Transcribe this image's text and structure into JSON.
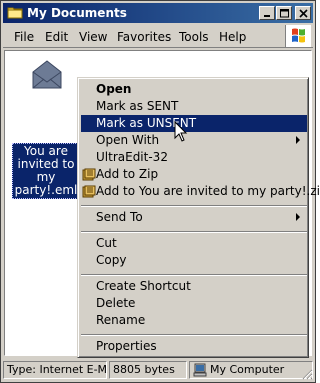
{
  "window": {
    "title": "My Documents"
  },
  "menubar": {
    "items": [
      "File",
      "Edit",
      "View",
      "Favorites",
      "Tools",
      "Help"
    ]
  },
  "file": {
    "name": "You are invited to my party!.eml",
    "label_lines": [
      "You are",
      "invited to my",
      "party!.eml"
    ]
  },
  "context_menu": {
    "items": [
      {
        "label": "Open"
      },
      {
        "label": "Mark as SENT"
      },
      {
        "label": "Mark as UNSENT"
      },
      {
        "label": "Open With"
      },
      {
        "label": "UltraEdit-32"
      },
      {
        "label": "Add to Zip"
      },
      {
        "label": "Add to You are invited to my party!.zip"
      },
      {
        "label": "Send To"
      },
      {
        "label": "Cut"
      },
      {
        "label": "Copy"
      },
      {
        "label": "Create Shortcut"
      },
      {
        "label": "Delete"
      },
      {
        "label": "Rename"
      },
      {
        "label": "Properties"
      }
    ],
    "highlighted": "Mark as UNSENT"
  },
  "statusbar": {
    "type": "Type: Internet E-Ma",
    "size": "8805 bytes",
    "location": "My Computer"
  },
  "colors": {
    "titlebar": "#0a246a",
    "selection": "#0a246a",
    "face": "#d4d0c8"
  },
  "icons": [
    "folder-icon",
    "minimize-icon",
    "maximize-icon",
    "close-icon",
    "windows-logo-icon",
    "envelope-icon",
    "winzip-icon",
    "computer-icon",
    "arrow-cursor-icon"
  ]
}
